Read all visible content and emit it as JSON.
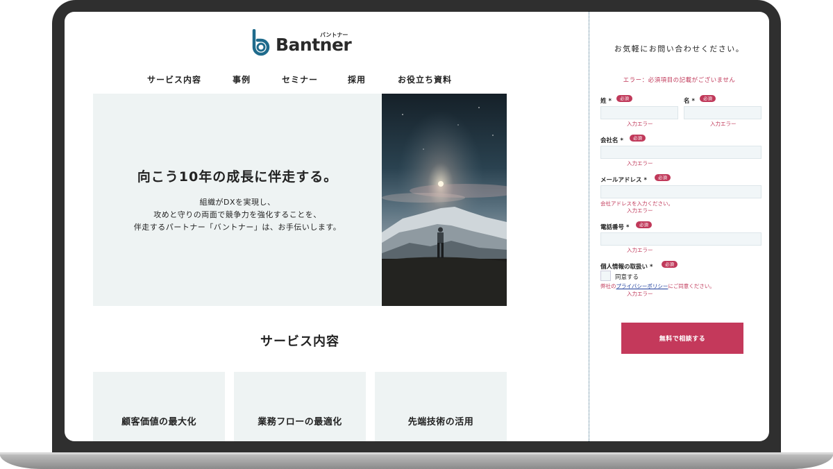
{
  "brand": {
    "name": "Bantner",
    "kana": "バントナー",
    "color_mark": "#1f6b8c"
  },
  "nav": {
    "items": [
      "サービス内容",
      "事例",
      "セミナー",
      "採用",
      "お役立ち資料"
    ]
  },
  "hero": {
    "title": "向こう10年の成長に伴走する。",
    "body_lines": [
      "組織がDXを実現し、",
      "攻めと守りの両面で競争力を強化することを、",
      "伴走するパートナー「バントナー」は、お手伝いします。"
    ]
  },
  "services": {
    "title": "サービス内容",
    "cards": [
      "顧客価値の最大化",
      "業務フローの最適化",
      "先端技術の活用"
    ]
  },
  "form": {
    "heading": "お気軽にお問い合わせください。",
    "error_top": "エラー：必須項目の記載がございません",
    "required_badge": "必須",
    "input_error": "入力エラー",
    "last_name_label": "姓 *",
    "first_name_label": "名 *",
    "company_label": "会社名 *",
    "email_label": "メールアドレス *",
    "email_hint": "会社アドレスを入力ください。",
    "phone_label": "電話番号 *",
    "privacy_label": "個人情報の取扱い *",
    "agree_label": "同意する",
    "privacy_prefix": "弊社の",
    "privacy_link": "プライバシーポリシー",
    "privacy_suffix": "にご同意ください。",
    "submit_label": "無料で相談する"
  },
  "colors": {
    "accent": "#c4395b",
    "panel": "#eef3f3",
    "frame": "#2f2f2f"
  }
}
